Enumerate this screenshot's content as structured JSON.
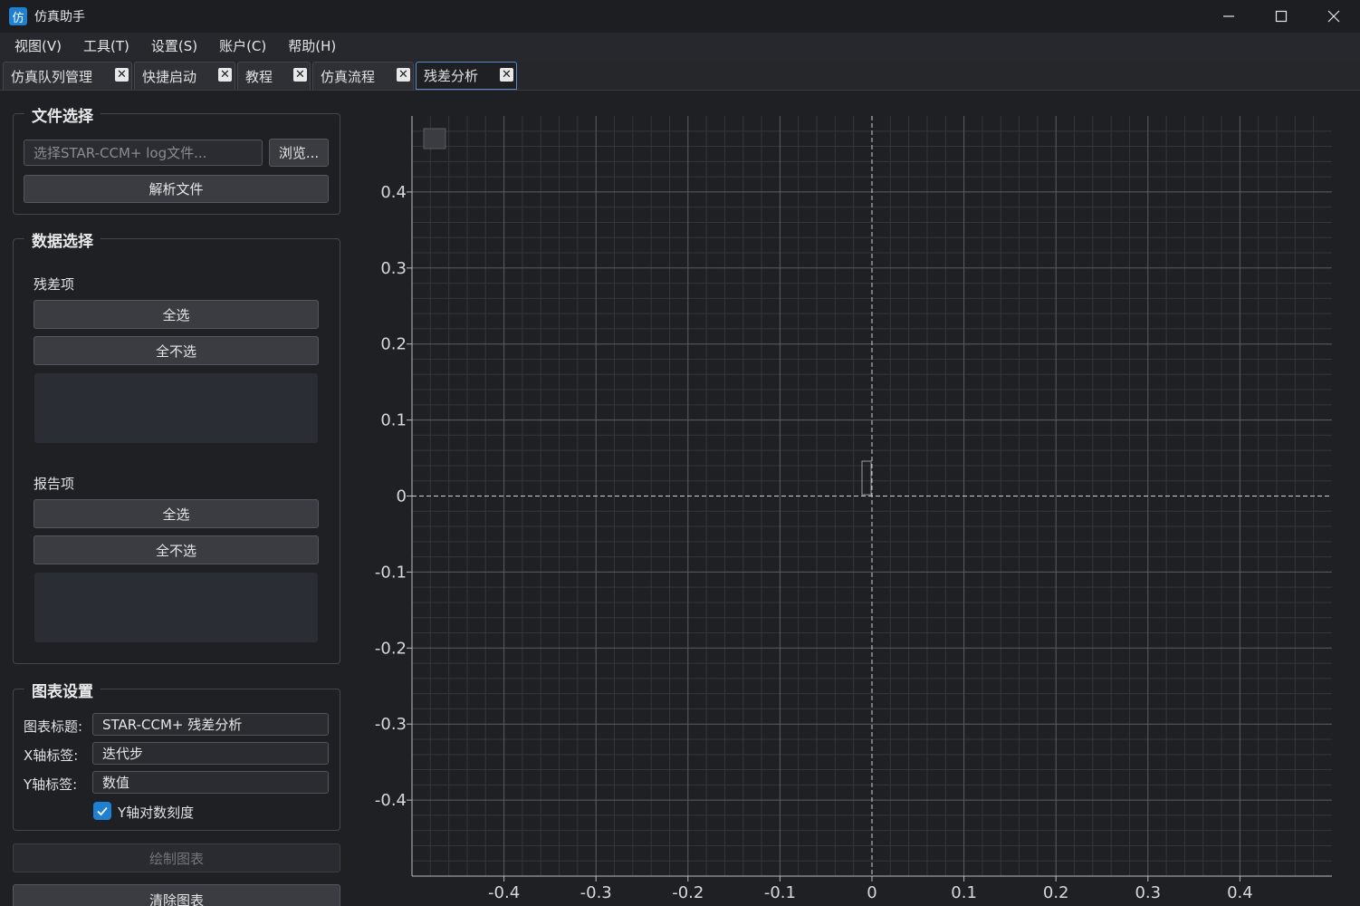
{
  "window": {
    "title": "仿真助手",
    "app_icon_char": "仿",
    "controls": [
      "minimize-icon",
      "maximize-icon",
      "close-icon"
    ]
  },
  "menu": {
    "items": [
      "视图(V)",
      "工具(T)",
      "设置(S)",
      "账户(C)",
      "帮助(H)"
    ]
  },
  "tabs": [
    {
      "label": "仿真队列管理",
      "active": false
    },
    {
      "label": "快捷启动",
      "active": false
    },
    {
      "label": "教程",
      "active": false
    },
    {
      "label": "仿真流程",
      "active": false
    },
    {
      "label": "残差分析",
      "active": true
    }
  ],
  "tab_close_glyph": "✕",
  "file_select": {
    "title": "文件选择",
    "input_placeholder": "选择STAR-CCM+ log文件...",
    "browse_label": "浏览...",
    "parse_label": "解析文件"
  },
  "data_select": {
    "title": "数据选择",
    "residuals": {
      "label": "残差项",
      "select_all": "全选",
      "select_none": "全不选",
      "items": []
    },
    "reports": {
      "label": "报告项",
      "select_all": "全选",
      "select_none": "全不选",
      "items": []
    }
  },
  "chart_settings": {
    "title": "图表设置",
    "title_label": "图表标题:",
    "title_value": "STAR-CCM+ 残差分析",
    "xlabel_label": "X轴标签:",
    "xlabel_value": "迭代步",
    "ylabel_label": "Y轴标签:",
    "ylabel_value": "数值",
    "log_scale_label": "Y轴对数刻度",
    "log_scale_checked": true
  },
  "actions": {
    "plot_label": "绘制图表",
    "plot_enabled": false,
    "clear_label": "清除图表"
  },
  "chart_data": {
    "type": "line",
    "title": "",
    "xlabel": "",
    "ylabel": "",
    "xlim": [
      -0.5,
      0.5
    ],
    "ylim": [
      -0.5,
      0.5
    ],
    "x_ticks": [
      -0.4,
      -0.3,
      -0.2,
      -0.1,
      0,
      0.1,
      0.2,
      0.3,
      0.4
    ],
    "y_ticks": [
      -0.4,
      -0.3,
      -0.2,
      -0.1,
      0,
      0.1,
      0.2,
      0.3,
      0.4
    ],
    "x_tick_labels": [
      "-0.4",
      "-0.3",
      "-0.2",
      "-0.1",
      "0",
      "0.1",
      "0.2",
      "0.3",
      "0.4"
    ],
    "y_tick_labels": [
      "-0.4",
      "-0.3",
      "-0.2",
      "-0.1",
      "0",
      "0.1",
      "0.2",
      "0.3",
      "0.4"
    ],
    "grid": true,
    "series": [],
    "colors": {
      "background": "#1f2024",
      "grid_major": "#5a5c62",
      "grid_minor": "#34363c",
      "axis": "#bdbdbd"
    }
  }
}
